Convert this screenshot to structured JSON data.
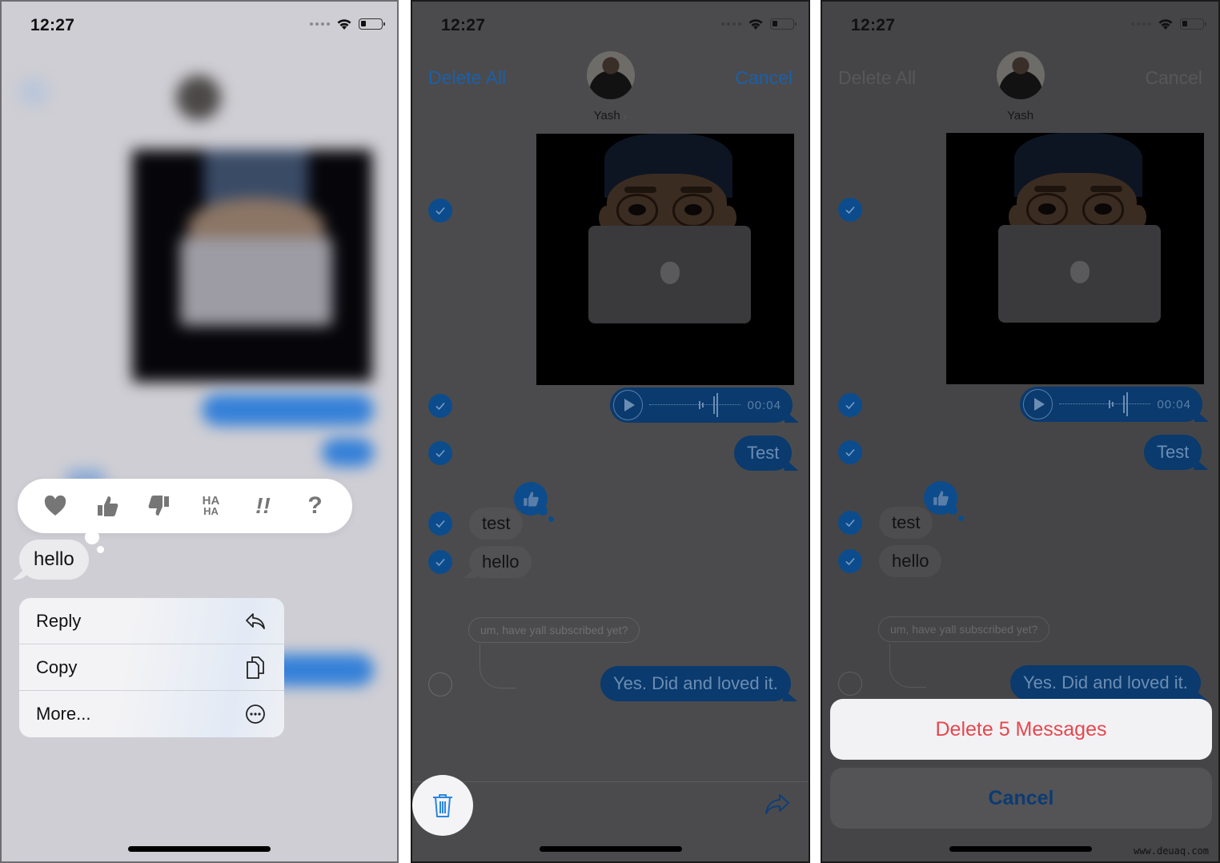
{
  "status_bar": {
    "time": "12:27"
  },
  "panel1": {
    "reactions": [
      {
        "name": "heart",
        "glyph": "♥"
      },
      {
        "name": "thumbs-up",
        "glyph": "👍"
      },
      {
        "name": "thumbs-down",
        "glyph": "👎"
      },
      {
        "name": "haha",
        "line1": "HA",
        "line2": "HA"
      },
      {
        "name": "exclamation",
        "glyph": "!!"
      },
      {
        "name": "question",
        "glyph": "?"
      }
    ],
    "selected_message": "hello",
    "context_menu": [
      {
        "label": "Reply",
        "icon": "reply-icon"
      },
      {
        "label": "Copy",
        "icon": "copy-icon"
      },
      {
        "label": "More...",
        "icon": "more-icon"
      }
    ]
  },
  "panel2": {
    "nav": {
      "left": "Delete All",
      "right": "Cancel",
      "contact": "Yash",
      "chevron": "›"
    },
    "messages": {
      "audio_duration": "00:04",
      "test_out": "Test",
      "test_in": "test",
      "hello_in": "hello",
      "reply_quote": "um, have yall subscribed yet?",
      "reply_out": "Yes. Did and loved it."
    },
    "selection": [
      true,
      true,
      true,
      true,
      true,
      false
    ]
  },
  "panel3": {
    "nav": {
      "left": "Delete All",
      "right": "Cancel",
      "contact": "Yash"
    },
    "messages": {
      "audio_duration": "00:04",
      "test_out": "Test",
      "test_in": "test",
      "hello_in": "hello",
      "reply_quote": "um, have yall subscribed yet?",
      "reply_out": "Yes. Did and loved it."
    },
    "action_sheet": {
      "destructive": "Delete 5 Messages",
      "cancel": "Cancel"
    },
    "watermark": "www.deuaq.com"
  },
  "colors": {
    "ios_blue": "#1a84ff",
    "destructive_red": "#e5484d",
    "selected_check": "#0c4c8c"
  }
}
